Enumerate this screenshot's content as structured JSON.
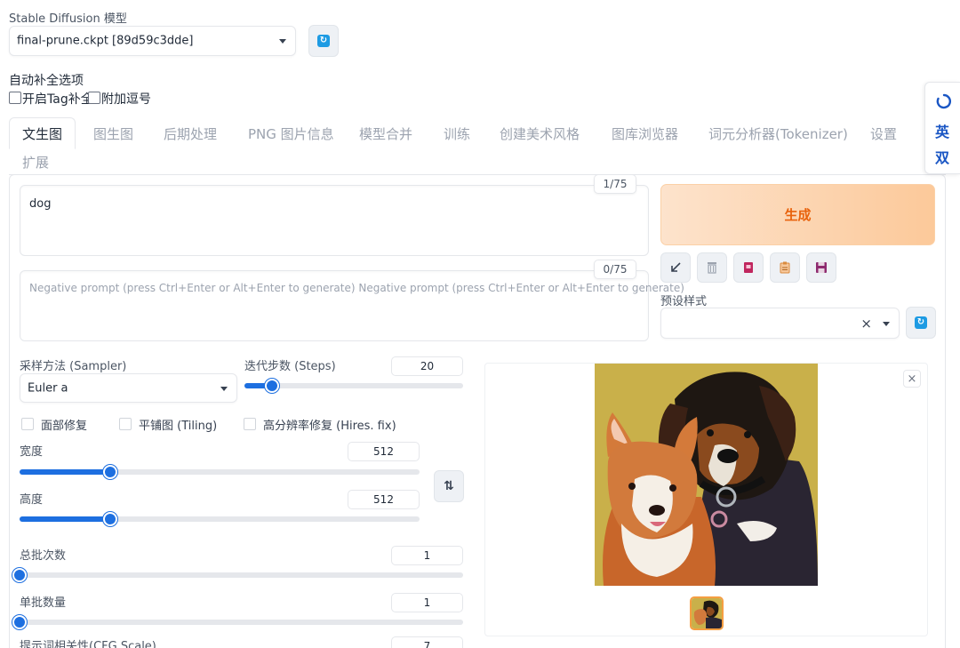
{
  "model": {
    "label": "Stable Diffusion 模型",
    "selected": "final-prune.ckpt [89d59c3dde]"
  },
  "autocomplete": {
    "label": "自动补全选项",
    "options": [
      {
        "label": "开启Tag补全",
        "checked": false
      },
      {
        "label": "附加逗号",
        "checked": false
      }
    ]
  },
  "tabs": [
    {
      "label": "文生图",
      "active": true
    },
    {
      "label": "图生图"
    },
    {
      "label": "后期处理"
    },
    {
      "label": "PNG 图片信息"
    },
    {
      "label": "模型合并"
    },
    {
      "label": "训练"
    },
    {
      "label": "创建美术风格"
    },
    {
      "label": "图库浏览器"
    },
    {
      "label": "词元分析器(Tokenizer)"
    },
    {
      "label": "设置"
    },
    {
      "label": "扩展"
    }
  ],
  "prompt": {
    "value": "dog",
    "counter": "1/75"
  },
  "negative_prompt": {
    "placeholder": "Negative prompt (press Ctrl+Enter or Alt+Enter to generate) Negative prompt (press Ctrl+Enter or Alt+Enter to generate)",
    "counter": "0/75"
  },
  "generate": {
    "label": "生成"
  },
  "tools": [
    "arrow-icon",
    "trash-icon",
    "card-icon",
    "clipboard-icon",
    "save-icon"
  ],
  "styles": {
    "label": "预设样式",
    "clear": "×"
  },
  "sampler": {
    "label": "采样方法 (Sampler)",
    "selected": "Euler a"
  },
  "steps": {
    "label": "迭代步数 (Steps)",
    "value": "20",
    "min": 1,
    "max": 150
  },
  "checks": {
    "face_restore": "面部修复",
    "tiling": "平铺图 (Tiling)",
    "hires": "高分辨率修复 (Hires. fix)"
  },
  "width": {
    "label": "宽度",
    "value": "512",
    "min": 64,
    "max": 2048
  },
  "height": {
    "label": "高度",
    "value": "512",
    "min": 64,
    "max": 2048
  },
  "swap": {
    "label": "⇅"
  },
  "batch_count": {
    "label": "总批次数",
    "value": "1",
    "min": 1,
    "max": 100
  },
  "batch_size": {
    "label": "单批数量",
    "value": "1",
    "min": 1,
    "max": 8
  },
  "cfg": {
    "label": "提示词相关性(CFG Scale)",
    "value": "7"
  },
  "gallery": {
    "close": "×"
  },
  "side_widget": {
    "top": "英",
    "bottom": "双"
  },
  "colors": {
    "accent": "#1d6fe0",
    "generate_text": "#e8620c",
    "generate_bg": "#fcc99a",
    "refresh": "#1e9be3",
    "side_text": "#1a56c4"
  }
}
